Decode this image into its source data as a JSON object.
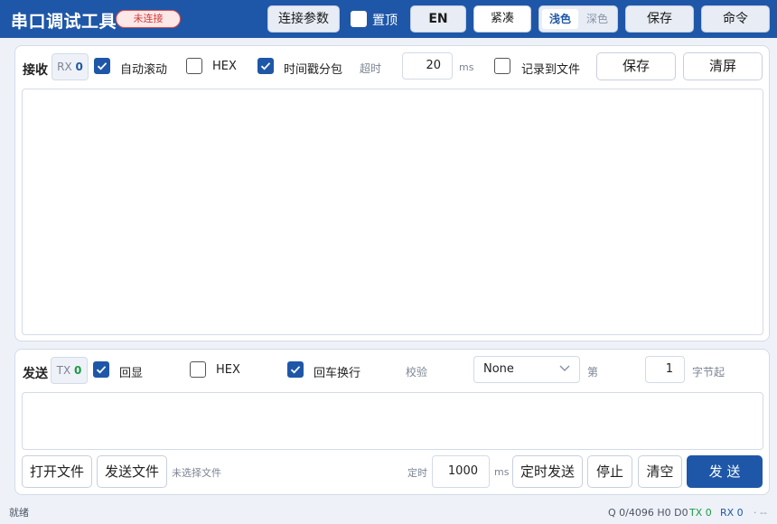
{
  "app": {
    "title": "串口调试工具",
    "connection_status": "未连接"
  },
  "toolbar": {
    "connect_params": "连接参数",
    "pin_top": {
      "label": "置顶",
      "checked": false
    },
    "language": "EN",
    "compact": "紧凑",
    "theme": {
      "light": "浅色",
      "dark": "深色",
      "selected": "浅色"
    },
    "save": "保存",
    "command": "命令"
  },
  "receive": {
    "title": "接收",
    "rx_label": "RX",
    "rx_count": "0",
    "auto_scroll": {
      "label": "自动滚动",
      "checked": true
    },
    "hex": {
      "label": "HEX",
      "checked": false
    },
    "timestamp_split": {
      "label": "时间戳分包",
      "checked": true
    },
    "timeout_label": "超时",
    "timeout_value": "20",
    "timeout_unit": "ms",
    "log_to_file": {
      "label": "记录到文件",
      "checked": false
    },
    "save_button": "保存",
    "clear_button": "清屏",
    "content": ""
  },
  "send": {
    "title": "发送",
    "tx_label": "TX",
    "tx_count": "0",
    "echo": {
      "label": "回显",
      "checked": true
    },
    "hex": {
      "label": "HEX",
      "checked": false
    },
    "append_newline": {
      "label": "回车换行",
      "checked": true
    },
    "checksum_label": "校验",
    "checksum_value": "None",
    "byte_prefix": "第",
    "byte_value": "1",
    "byte_suffix": "字节起",
    "content": "",
    "open_file": "打开文件",
    "send_file": "发送文件",
    "no_file": "未选择文件",
    "timer_label": "定时",
    "timer_value": "1000",
    "timer_unit": "ms",
    "timed_send": "定时发送",
    "stop": "停止",
    "clear": "清空",
    "send_button": "发 送"
  },
  "status": {
    "message": "就绪",
    "queue": "Q 0/4096 H0 D0",
    "tx": "TX 0",
    "rx": "RX 0",
    "extra": "· --"
  },
  "colors": {
    "accent": "#1f57a8",
    "danger": "#d23a3a",
    "tx": "#1c9a44"
  }
}
